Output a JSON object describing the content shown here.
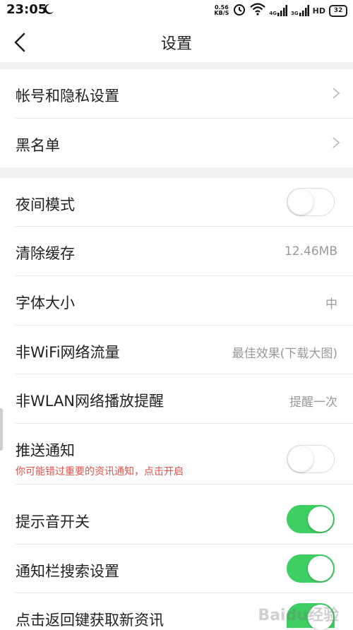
{
  "status": {
    "time": "23:05",
    "speed_top": "0.56",
    "speed_bottom": "KB/S",
    "net1": "4G",
    "net2": "3G",
    "hd": "HD",
    "battery": "32"
  },
  "header": {
    "title": "设置"
  },
  "account": {
    "items": [
      {
        "label": "帐号和隐私设置"
      },
      {
        "label": "黑名单"
      }
    ]
  },
  "settings": {
    "night_mode": {
      "label": "夜间模式",
      "on": false
    },
    "clear_cache": {
      "label": "清除缓存",
      "value": "12.46MB"
    },
    "font_size": {
      "label": "字体大小",
      "value": "中"
    },
    "non_wifi": {
      "label": "非WiFi网络流量",
      "value": "最佳效果(下载大图)"
    },
    "non_wlan": {
      "label": "非WLAN网络播放提醒",
      "value": "提醒一次"
    },
    "push": {
      "label": "推送通知",
      "warning": "你可能错过重要的资讯通知，点击开启",
      "on": false
    },
    "sound": {
      "label": "提示音开关",
      "on": true
    },
    "notif_search": {
      "label": "通知栏搜索设置",
      "on": true
    },
    "back_refresh": {
      "label": "点击返回键获取新资讯",
      "on": true
    }
  },
  "colors": {
    "accent_on": "#3dcf62",
    "warning": "#e0524a",
    "value_text": "#999999"
  },
  "watermark": "Baidu经验"
}
